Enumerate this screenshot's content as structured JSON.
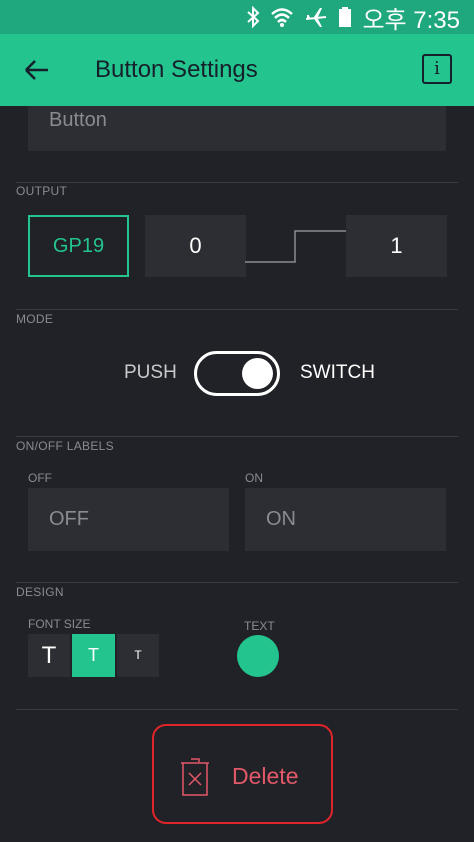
{
  "status_bar": {
    "time": "오후 7:35"
  },
  "appbar": {
    "title": "Button Settings",
    "info_glyph": "i"
  },
  "name_field": {
    "value": "Button"
  },
  "output": {
    "section_label": "OUTPUT",
    "pin": "GP19",
    "low_value": "0",
    "high_value": "1"
  },
  "mode": {
    "section_label": "MODE",
    "push_label": "PUSH",
    "switch_label": "SWITCH",
    "selected": "SWITCH"
  },
  "onoff": {
    "section_label": "ON/OFF LABELS",
    "off_label": "OFF",
    "off_value": "OFF",
    "on_label": "ON",
    "on_value": "ON"
  },
  "design": {
    "section_label": "DESIGN",
    "font_size_label": "FONT SIZE",
    "font_sizes": [
      "T",
      "T",
      "T"
    ],
    "selected_font_size": "medium",
    "text_color_label": "TEXT",
    "text_color": "#23c48e"
  },
  "delete": {
    "label": "Delete"
  },
  "colors": {
    "accent": "#23c48e",
    "background": "#212227",
    "danger": "#e0252a"
  }
}
